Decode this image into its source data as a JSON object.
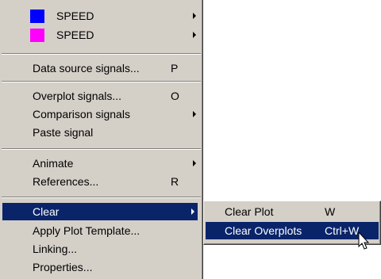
{
  "menu": {
    "items": [
      {
        "label": "SPEED",
        "swatch": "#0000ff",
        "has_submenu": true
      },
      {
        "label": "SPEED",
        "swatch": "#ff00ff",
        "has_submenu": true
      },
      {
        "label": "Data source signals...",
        "accel": "P"
      },
      {
        "label": "Overplot signals...",
        "accel": "O"
      },
      {
        "label": "Comparison signals",
        "has_submenu": true
      },
      {
        "label": "Paste signal"
      },
      {
        "label": "Animate",
        "has_submenu": true
      },
      {
        "label": "References...",
        "accel": "R"
      },
      {
        "label": "Clear",
        "has_submenu": true,
        "highlighted": true
      },
      {
        "label": "Apply Plot Template..."
      },
      {
        "label": "Linking..."
      },
      {
        "label": "Properties..."
      }
    ]
  },
  "submenu": {
    "items": [
      {
        "label": "Clear Plot",
        "accel": "W"
      },
      {
        "label": "Clear Overplots",
        "accel": "Ctrl+W",
        "highlighted": true
      }
    ]
  },
  "colors": {
    "highlight": "#0a246a",
    "menu_bg": "#d4d0c8"
  }
}
